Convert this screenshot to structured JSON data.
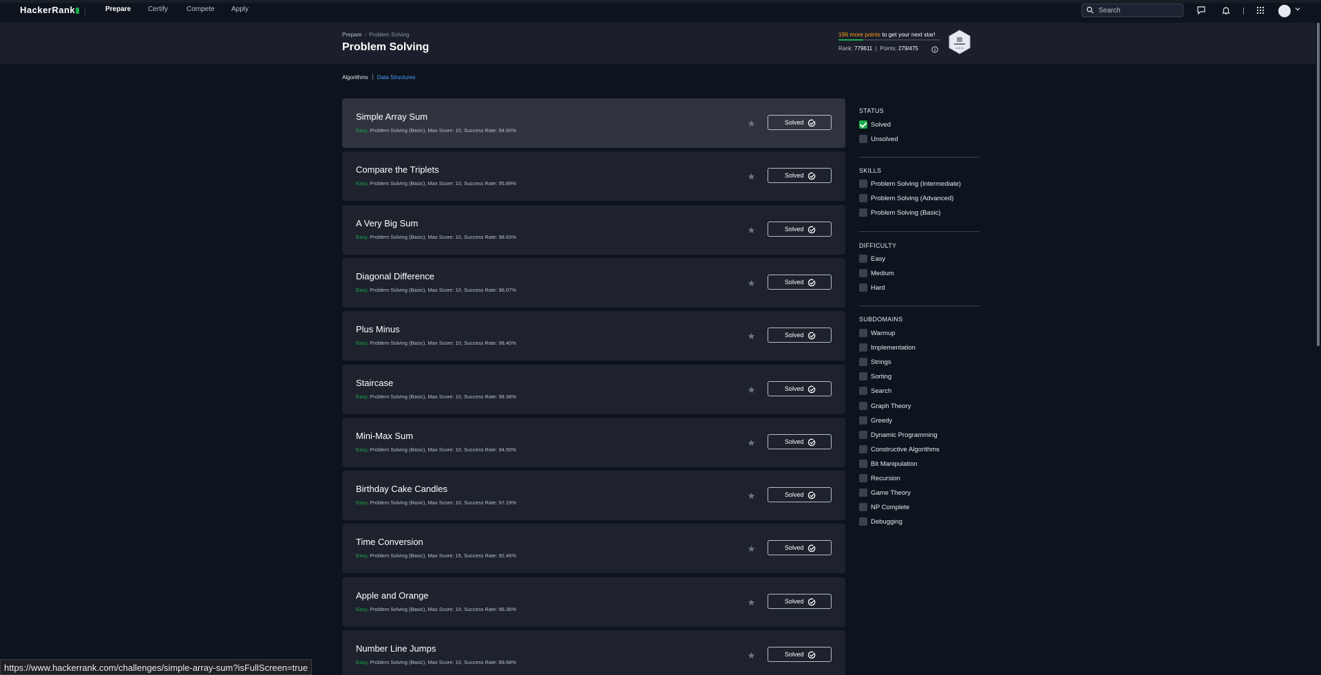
{
  "nav": {
    "logo": "HackerRank",
    "tabs": [
      {
        "label": "Prepare"
      },
      {
        "label": "Certify"
      },
      {
        "label": "Compete"
      },
      {
        "label": "Apply"
      }
    ],
    "search_placeholder": "Search"
  },
  "header": {
    "breadcrumb": [
      "Prepare",
      "Problem Solving"
    ],
    "title": "Problem Solving",
    "points_needed": "196 more points",
    "points_suffix": " to get your next star!",
    "progress_fraction": 0.24,
    "rank_label": "Rank:",
    "rank_value": "779611",
    "points_label": "Points:",
    "points_value": "279/475"
  },
  "subtabs": [
    "Algorithms",
    "Data Structures"
  ],
  "challenges": [
    {
      "title": "Simple Array Sum",
      "difficulty": "Easy,",
      "meta": " Problem Solving (Basic), Max Score: 10, Success Rate: 94.60%",
      "button": "Solved"
    },
    {
      "title": "Compare the Triplets",
      "difficulty": "Easy,",
      "meta": " Problem Solving (Basic), Max Score: 10, Success Rate: 95.89%",
      "button": "Solved"
    },
    {
      "title": "A Very Big Sum",
      "difficulty": "Easy,",
      "meta": " Problem Solving (Basic), Max Score: 10, Success Rate: 98.83%",
      "button": "Solved"
    },
    {
      "title": "Diagonal Difference",
      "difficulty": "Easy,",
      "meta": " Problem Solving (Basic), Max Score: 10, Success Rate: 96.07%",
      "button": "Solved"
    },
    {
      "title": "Plus Minus",
      "difficulty": "Easy,",
      "meta": " Problem Solving (Basic), Max Score: 10, Success Rate: 98.40%",
      "button": "Solved"
    },
    {
      "title": "Staircase",
      "difficulty": "Easy,",
      "meta": " Problem Solving (Basic), Max Score: 10, Success Rate: 98.38%",
      "button": "Solved"
    },
    {
      "title": "Mini-Max Sum",
      "difficulty": "Easy,",
      "meta": " Problem Solving (Basic), Max Score: 10, Success Rate: 94.50%",
      "button": "Solved"
    },
    {
      "title": "Birthday Cake Candles",
      "difficulty": "Easy,",
      "meta": " Problem Solving (Basic), Max Score: 10, Success Rate: 97.19%",
      "button": "Solved"
    },
    {
      "title": "Time Conversion",
      "difficulty": "Easy,",
      "meta": " Problem Solving (Basic), Max Score: 15, Success Rate: 92.46%",
      "button": "Solved"
    },
    {
      "title": "Apple and Orange",
      "difficulty": "Easy,",
      "meta": " Problem Solving (Basic), Max Score: 10, Success Rate: 96.36%",
      "button": "Solved"
    },
    {
      "title": "Number Line Jumps",
      "difficulty": "Easy,",
      "meta": " Problem Solving (Basic), Max Score: 10, Success Rate: 89.68%",
      "button": "Solved"
    }
  ],
  "filters": {
    "status": {
      "heading": "STATUS",
      "items": [
        {
          "label": "Solved",
          "checked": true
        },
        {
          "label": "Unsolved",
          "checked": false
        }
      ]
    },
    "skills": {
      "heading": "SKILLS",
      "items": [
        {
          "label": "Problem Solving (Intermediate)"
        },
        {
          "label": "Problem Solving (Advanced)"
        },
        {
          "label": "Problem Solving (Basic)"
        }
      ]
    },
    "difficulty": {
      "heading": "DIFFICULTY",
      "items": [
        {
          "label": "Easy"
        },
        {
          "label": "Medium"
        },
        {
          "label": "Hard"
        }
      ]
    },
    "subdomains": {
      "heading": "SUBDOMAINS",
      "items": [
        {
          "label": "Warmup"
        },
        {
          "label": "Implementation"
        },
        {
          "label": "Strings"
        },
        {
          "label": "Sorting"
        },
        {
          "label": "Search"
        },
        {
          "label": "Graph Theory"
        },
        {
          "label": "Greedy"
        },
        {
          "label": "Dynamic Programming"
        },
        {
          "label": "Constructive Algorithms"
        },
        {
          "label": "Bit Manipulation"
        },
        {
          "label": "Recursion"
        },
        {
          "label": "Game Theory"
        },
        {
          "label": "NP Complete"
        },
        {
          "label": "Debugging"
        }
      ]
    }
  },
  "status_bar_url": "https://www.hackerrank.com/challenges/simple-array-sum?isFullScreen=true",
  "colors": {
    "accent": "#1ba94c",
    "easy": "#1ba94c",
    "highlight": "#ffa116",
    "link": "#4b9cff",
    "background": "#0e141e"
  }
}
